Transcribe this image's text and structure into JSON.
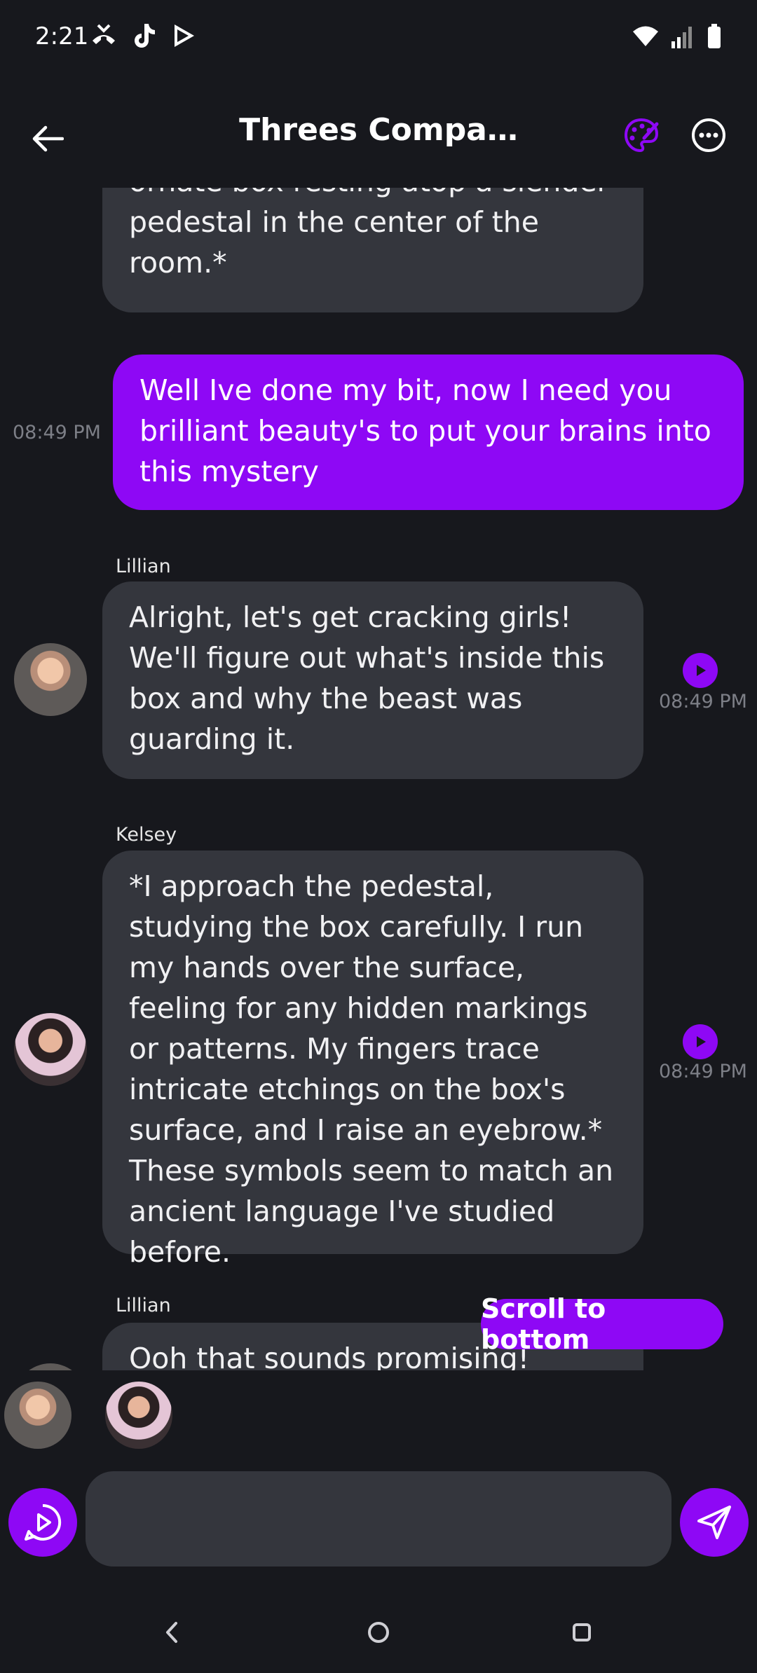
{
  "status": {
    "time": "2:21"
  },
  "header": {
    "title": "Threes Compa…",
    "icons": [
      "back-arrow-icon",
      "palette-icon",
      "more-options-icon"
    ]
  },
  "messages": [
    {
      "sender": "",
      "text": "ornate box resting atop a slender pedestal in the center of the room.*",
      "time": ""
    },
    {
      "sender": "me",
      "text": "Well Ive done my bit, now I need you brilliant beauty's to put your brains into this mystery",
      "time": "08:49 PM"
    },
    {
      "sender": "Lillian",
      "text": "Alright, let's get cracking girls! We'll figure out what's inside this box and why the beast was guarding it.",
      "time": "08:49 PM"
    },
    {
      "sender": "Kelsey",
      "text": "*I approach the pedestal, studying the box carefully. I run my hands over the surface, feeling for any hidden markings or patterns. My fingers trace intricate etchings on the box's surface, and I raise an eyebrow.* These symbols seem to match an ancient language I've studied before.",
      "time": "08:49 PM"
    },
    {
      "sender": "Lillian",
      "text": "Ooh that sounds promising! Maybe",
      "time": ""
    }
  ],
  "scroll_button": {
    "label": "Scroll to bottom"
  },
  "composer": {
    "value": "",
    "placeholder": ""
  },
  "colors": {
    "accent": "#8e08f5",
    "background": "#17181d",
    "bubble": "#34363d"
  }
}
